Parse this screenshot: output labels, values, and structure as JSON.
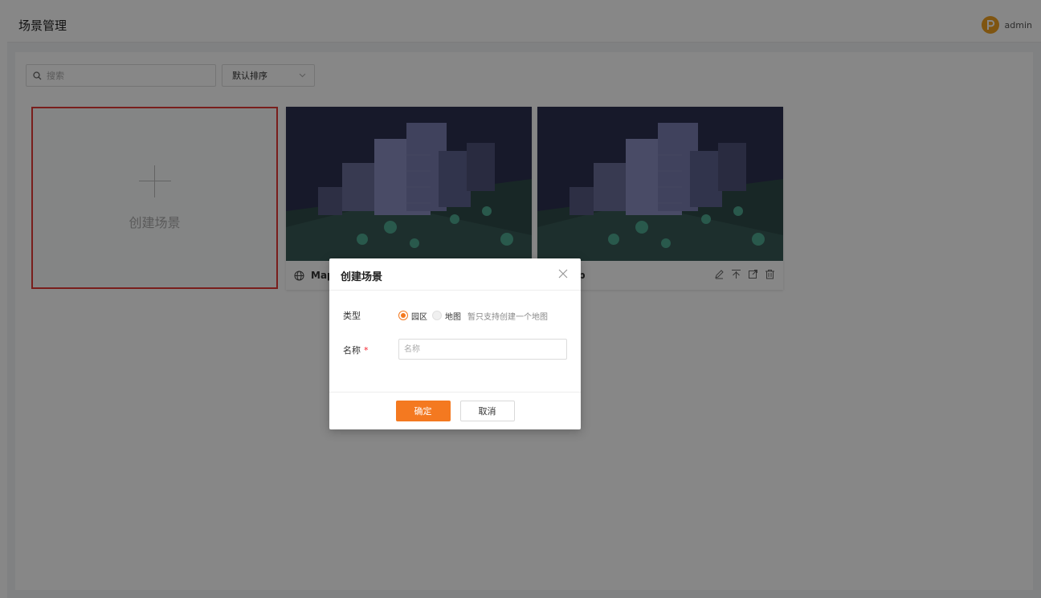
{
  "header": {
    "title": "场景管理",
    "user_name": "admin",
    "avatar_letter": "P"
  },
  "toolbar": {
    "search_placeholder": "搜索",
    "sort_value": "默认排序"
  },
  "create_card": {
    "label": "创建场景"
  },
  "scenes": [
    {
      "name": "Map"
    },
    {
      "name": "Map"
    }
  ],
  "dialog": {
    "title": "创建场景",
    "type_label": "类型",
    "type_options": [
      "园区",
      "地图"
    ],
    "type_selected": "园区",
    "type_hint": "暂只支持创建一个地图",
    "name_label": "名称",
    "required_mark": "*",
    "name_placeholder": "名称",
    "name_value": "",
    "confirm_label": "确定",
    "cancel_label": "取消"
  },
  "colors": {
    "accent": "#f47920",
    "highlight_border": "#e53935",
    "avatar": "#f0a020"
  }
}
